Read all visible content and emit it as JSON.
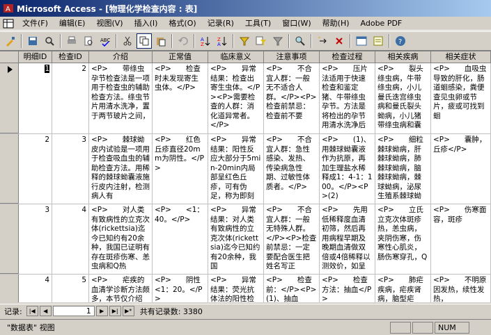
{
  "window": {
    "title": "Microsoft Access - [物理化学检查内容 : 表]"
  },
  "menu": [
    "文件(F)",
    "编辑(E)",
    "视图(V)",
    "插入(I)",
    "格式(O)",
    "记录(R)",
    "工具(T)",
    "窗口(W)",
    "帮助(H)",
    "Adobe PDF"
  ],
  "columns": [
    "明细ID",
    "检查ID",
    "介绍",
    "正常值",
    "临床意义",
    "注意事项",
    "检查过程",
    "相关疾病",
    "相关症状"
  ],
  "rows": [
    {
      "id": "1",
      "check_id": "2",
      "intro": "<P>　　带绦虫孕节检查法是一项用于检查虫的辅助检查方法。绦虫节片用清水洗净，置于两节玻片之间，",
      "normal": "<P>　　检查时未发现寄生虫体。</P>",
      "clinical": "<P>　　异常结果：检查出寄生虫体。</P><P>需要检查的人群：消化道异常者。</P>",
      "notes": "<P>　　不合宜人群：一般无不适合人群。</P><P>检查前禁忌：检查前不要",
      "process": "<P>　　压片法适用于快速检查和鉴定猪、牛带绦虫孕节。方法是将检出的孕节用清水洗净后",
      "disease": "<P>　　裂头绦虫病，牛带绦虫病，小儿曼氏迭宫绦虫病和曼氏裂头蚴病，小儿猪带绦虫病和囊",
      "symptom": "<P>　　血吸虫导致的肝化，肠道蛔感染，粪便查见虫卵或节片，疲或可找到蛔"
    },
    {
      "id": "2",
      "check_id": "3",
      "intro": "<P>　　棘球蚴皮内试验是一项用于检查吸血虫的辅助检查方法。用稀释的棘球蚴囊液施行皮内注射，检测病人有",
      "normal": "<P>　　红色丘疹直径20mm为阴性。</P>",
      "clinical": "<P>　　异常结果：阳性反应大部分于5min-20min内局部呈红色丘疹，可有伪足，称为即刻",
      "notes": "<P>　　不合宜人群：急性感染、发热、传染病急性期、过敏性体质者。</P>",
      "process": "<P>　　(1)、用棘球蚴囊液作为抗原，再加生理盐水稀释成1：4-1：100。</P><P>(2)",
      "disease": "<P>　　细粒棘球蚴病，肝棘球蚴病，肺棘球蚴病，脑棘球蚴病，棘球蚴病，泌尿生殖系棘球蚴",
      "symptom": "<P>　　囊肿，丘疹</P>"
    },
    {
      "id": "3",
      "check_id": "4",
      "intro": "<P>　　对人类有致病性的立克次体(rickettsia)迄今已知约有20余种，我国已证明有存在斑疹伤寒、恙虫病和Q热",
      "normal": "<P>　　<1：40。</P>",
      "clinical": "<P>　　异常结果：对人类有致病性的立克次体(rickettsia)迄今已知约有20余种，我国",
      "notes": "<P>　　不合宜人群：一般无特殊人群。</P><P>检查前禁忌：一定要配合医生把姓名写正",
      "process": "<P>　　先用低稀释度血清初筛，然后再用病程早期及晚期血清做双倍或4倍稀释以测效价，如呈",
      "disease": "<P>　　立氏立克次体斑疹热，恙虫病，夹阴伤寒，伤寒性心肌炎，肠伤寒穿孔，Q",
      "symptom": "<P>　　伤寒面容，斑疹"
    },
    {
      "id": "4",
      "check_id": "5",
      "intro": "<P>　　疟疾的血清学诊断方法颇多，本节仅介绍",
      "normal": "<P>　　阴性<1：20。</P>",
      "clinical": "<P>　　异常结果：荧光抗体法的阳性检",
      "notes": "<P>　　检查前：</P><P>(1)、抽血",
      "process": "<P>　　检查方法：抽血</P>",
      "disease": "<P>　　肺疟疾病，疟疾肾病，脑型疟",
      "symptom": "<P>　　不明原因发热，续性发热，"
    }
  ],
  "nav": {
    "label": "记录:",
    "current": "1",
    "total_label": "共有记录数: 3380"
  },
  "status": {
    "view": "\"数据表\" 视图",
    "num": "NUM"
  }
}
